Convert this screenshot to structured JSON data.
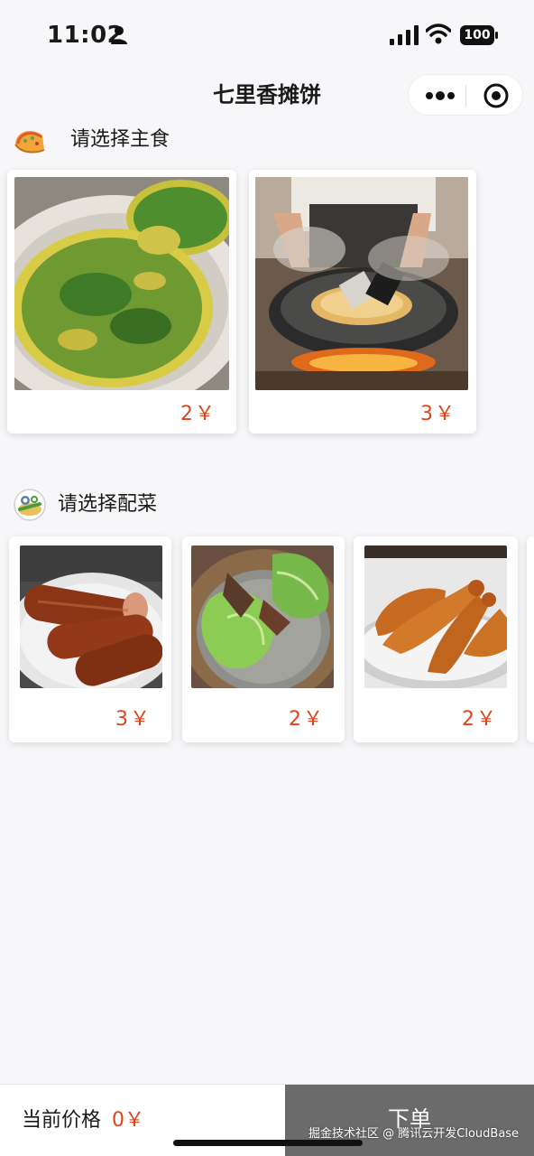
{
  "status_bar": {
    "time": "11:02",
    "battery": "100",
    "icons": [
      "person-icon",
      "signal-icon",
      "wifi-icon",
      "battery-icon"
    ]
  },
  "nav": {
    "title": "七里香摊饼",
    "icons": [
      "more-icon",
      "close-target-icon"
    ]
  },
  "staples": {
    "title": "请选择主食",
    "icon": "pancake-icon",
    "items": [
      {
        "image": "green-onion-pancake-photo",
        "price": "2￥"
      },
      {
        "image": "griddle-cooking-photo",
        "price": "3￥"
      }
    ]
  },
  "sides": {
    "title": "请选择配菜",
    "icon": "vegetable-plate-icon",
    "items": [
      {
        "image": "sausage-photo",
        "price": "3￥"
      },
      {
        "image": "lettuce-photo",
        "price": "2￥"
      },
      {
        "image": "fried-chicken-leg-photo",
        "price": "2￥"
      }
    ]
  },
  "footer": {
    "total_label": "当前价格",
    "total_price": "0￥",
    "order_label": "下单",
    "watermark": "掘金技术社区 @ 腾讯云开发CloudBase"
  },
  "colors": {
    "accent_price": "#e0441c",
    "order_button": "#6b6b6b",
    "background": "#f7f6f8"
  }
}
